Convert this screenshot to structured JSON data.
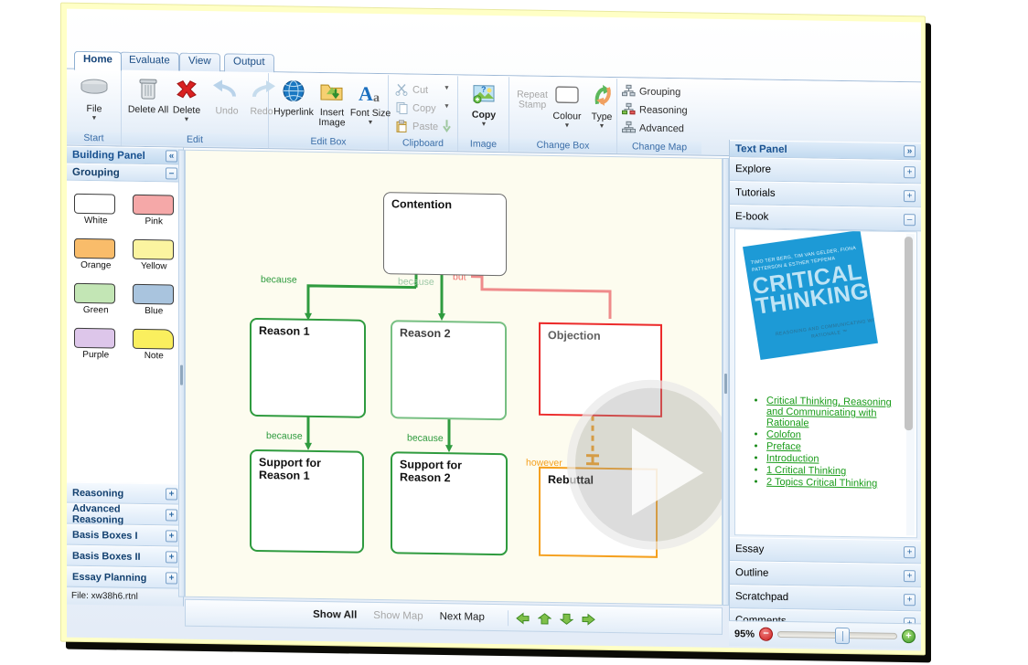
{
  "app": {
    "file_label": "File: xw38h6.rtnl"
  },
  "ribbon": {
    "tabs": [
      {
        "label": "Home",
        "active": true
      },
      {
        "label": "Evaluate",
        "active": false
      },
      {
        "label": "View",
        "active": false
      },
      {
        "label": "Output",
        "active": false
      }
    ],
    "groups": [
      {
        "title": "Start"
      },
      {
        "title": "Edit"
      },
      {
        "title": "Edit Box"
      },
      {
        "title": "Clipboard"
      },
      {
        "title": "Image"
      },
      {
        "title": "Change Box"
      },
      {
        "title": "Change Map"
      }
    ],
    "start": {
      "file": "File"
    },
    "edit": {
      "delete_all": "Delete All",
      "delete": "Delete",
      "undo": "Undo",
      "redo": "Redo"
    },
    "edit_box": {
      "hyperlink": "Hyperlink",
      "insert_image": "Insert Image",
      "font_size": "Font Size"
    },
    "clipboard": {
      "cut": "Cut",
      "copy": "Copy",
      "paste": "Paste"
    },
    "image": {
      "copy": "Copy"
    },
    "change_box": {
      "repeat_stamp": "Repeat Stamp",
      "colour": "Colour",
      "type": "Type"
    },
    "change_map": {
      "grouping": "Grouping",
      "reasoning": "Reasoning",
      "advanced": "Advanced"
    }
  },
  "building_panel": {
    "title": "Building Panel",
    "collapse_icon": "«",
    "grouping": {
      "title": "Grouping",
      "toggle": "–",
      "swatches": [
        {
          "label": "White",
          "color": "#ffffff"
        },
        {
          "label": "Pink",
          "color": "#f5a8a8"
        },
        {
          "label": "Orange",
          "color": "#f9bc6a"
        },
        {
          "label": "Yellow",
          "color": "#fbf4a0"
        },
        {
          "label": "Green",
          "color": "#c3e6b5"
        },
        {
          "label": "Blue",
          "color": "#a9c4de"
        },
        {
          "label": "Purple",
          "color": "#ddc6ea"
        },
        {
          "label": "Note",
          "color": "#faef5e"
        }
      ]
    },
    "sections": [
      {
        "label": "Reasoning",
        "toggle": "+"
      },
      {
        "label": "Advanced Reasoning",
        "toggle": "+"
      },
      {
        "label": "Basis Boxes I",
        "toggle": "+"
      },
      {
        "label": "Basis Boxes II",
        "toggle": "+"
      },
      {
        "label": "Essay Planning",
        "toggle": "+"
      }
    ]
  },
  "map": {
    "boxes": [
      {
        "id": "contention",
        "text": "Contention",
        "color": "#6b6b6b"
      },
      {
        "id": "reason1",
        "text": "Reason 1",
        "color": "#2f9b3f"
      },
      {
        "id": "reason2",
        "text": "Reason 2",
        "color": "#2f9b3f"
      },
      {
        "id": "objection",
        "text": "Objection",
        "color": "#ec2b2b"
      },
      {
        "id": "support1",
        "text": "Support for Reason 1",
        "color": "#2f9b3f"
      },
      {
        "id": "support2",
        "text": "Support for Reason 2",
        "color": "#2f9b3f"
      },
      {
        "id": "rebuttal",
        "text": "Rebuttal",
        "color": "#f5a01e"
      }
    ],
    "connectors": [
      {
        "id": "c1",
        "label": "because",
        "color": "#2f9b3f"
      },
      {
        "id": "c2",
        "label": "because",
        "color": "#2f9b3f"
      },
      {
        "id": "c3",
        "label": "but",
        "color": "#ec5a5a"
      },
      {
        "id": "c4",
        "label": "because",
        "color": "#2f9b3f"
      },
      {
        "id": "c5",
        "label": "because",
        "color": "#2f9b3f"
      },
      {
        "id": "c6",
        "label": "however",
        "color": "#f5a01e"
      }
    ]
  },
  "map_bar": {
    "show_all": "Show All",
    "show_map": "Show Map",
    "next_map": "Next Map",
    "arrows": [
      "left-arrow",
      "up-arrow",
      "down-arrow",
      "right-arrow"
    ]
  },
  "text_panel": {
    "title": "Text Panel",
    "expand_icon": "»",
    "sections_top": [
      {
        "label": "Explore",
        "toggle": "+"
      },
      {
        "label": "Tutorials",
        "toggle": "+"
      },
      {
        "label": "E-book",
        "toggle": "–"
      }
    ],
    "ebook": {
      "cover": {
        "authors": "TIMO TER BERG, TIM VAN GELDER, FIONA PATTERSON & ESTHER TEPPEMA",
        "title_line1": "CRITICAL",
        "title_line2": "THINKING",
        "subtitle": "REASONING AND COMMUNICATING WITH RATIONALE ™"
      },
      "links": [
        "Critical Thinking, Reasoning and Communicating with Rationale",
        "Colofon",
        "Preface",
        "Introduction",
        "1 Critical Thinking",
        "2 Topics Critical Thinking"
      ]
    },
    "sections_bottom": [
      {
        "label": "Essay",
        "toggle": "+"
      },
      {
        "label": "Outline",
        "toggle": "+"
      },
      {
        "label": "Scratchpad",
        "toggle": "+"
      },
      {
        "label": "Comments",
        "toggle": "+"
      }
    ]
  },
  "zoom": {
    "level": "95%",
    "minus": "−",
    "plus": "+"
  },
  "colors": {
    "green": "#2f9b3f",
    "red": "#ec2b2b",
    "orange": "#f5a01e",
    "gray": "#6b6b6b",
    "accent_blue": "#17508f",
    "canvas": "#fdfcef"
  }
}
